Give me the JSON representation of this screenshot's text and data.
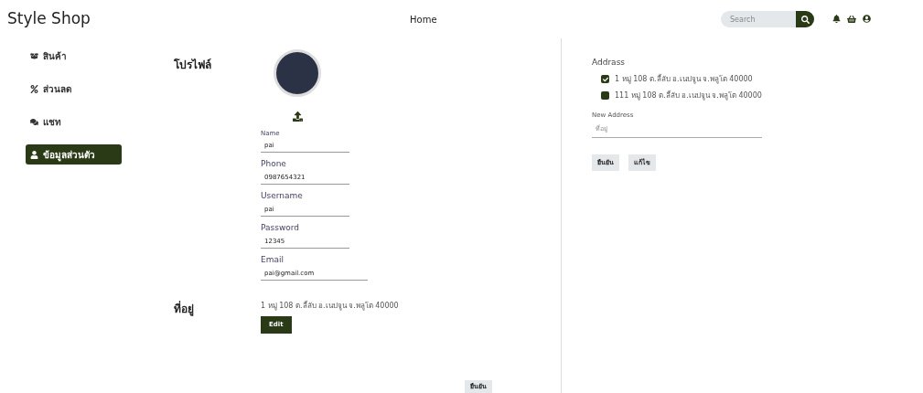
{
  "brand": "Style Shop",
  "nav": {
    "home": "Home"
  },
  "search": {
    "placeholder": "Search"
  },
  "sidebar": {
    "items": [
      {
        "label": "สินค้า",
        "selected": false
      },
      {
        "label": "ส่วนลด",
        "selected": false
      },
      {
        "label": "แชท",
        "selected": false
      },
      {
        "label": "ข้อมูลส่วนตัว",
        "selected": true
      }
    ]
  },
  "profile": {
    "heading": "โปรไฟล์",
    "fields": [
      {
        "label": "Name",
        "value": "pai"
      },
      {
        "label": "Phone",
        "value": "0987654321"
      },
      {
        "label": "Username",
        "value": "pai"
      },
      {
        "label": "Password",
        "value": "12345"
      },
      {
        "label": "Email",
        "value": "pai@gmail.com"
      }
    ],
    "address_heading": "ที่อยู่",
    "address": "1 หมู่ 108 ต.ลี้ลับ อ.เนปจูน จ.พลูโต 40000",
    "edit": "Edit",
    "confirm": "ยืนยัน"
  },
  "addresses": {
    "title": "Addrass",
    "items": [
      {
        "text": "1 หมู่ 108 ต.ลี้ลับ อ.เนปจูน จ.พลูโต 40000",
        "checked": true
      },
      {
        "text": "111 หมู่ 108 ต.ลี้ลับ อ.เนปจูน จ.พลูโต 40000",
        "checked": false
      }
    ],
    "new_label": "New Address",
    "new_placeholder": "ที่อยู่",
    "buttons": [
      "ยืนยัน",
      "แก้ไข"
    ]
  }
}
